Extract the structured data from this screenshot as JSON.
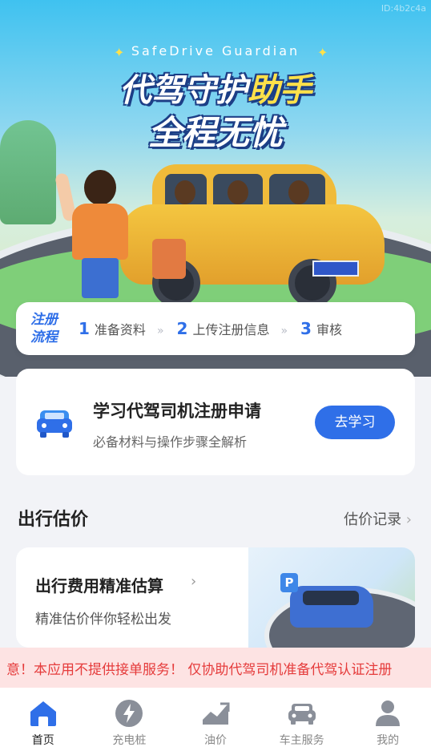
{
  "watermark": "ID:4b2c4a",
  "hero": {
    "tagline": "SafeDrive Guardian",
    "title_line1_a": "代驾守护",
    "title_line1_b": "助手",
    "title_line2": "全程无忧"
  },
  "steps": {
    "tag": "注册流程",
    "items": [
      {
        "num": "1",
        "label": "准备资料"
      },
      {
        "num": "2",
        "label": "上传注册信息"
      },
      {
        "num": "3",
        "label": "审核"
      }
    ],
    "separator": "»"
  },
  "learn_card": {
    "title": "学习代驾司机注册申请",
    "subtitle": "必备材料与操作步骤全解析",
    "button": "去学习",
    "icon": "car-icon"
  },
  "estimate_section": {
    "title": "出行估价",
    "link": "估价记录",
    "card_title": "出行费用精准估算",
    "card_subtitle": "精准估价伴你轻松出发",
    "sign_text": "P"
  },
  "notice": "意！本应用不提供接单服务！ 仅协助代驾司机准备代驾认证注册",
  "tabbar": [
    {
      "label": "首页",
      "icon": "home-icon",
      "active": true
    },
    {
      "label": "充电桩",
      "icon": "lightning-icon",
      "active": false
    },
    {
      "label": "油价",
      "icon": "chart-trend-icon",
      "active": false
    },
    {
      "label": "车主服务",
      "icon": "car-icon",
      "active": false
    },
    {
      "label": "我的",
      "icon": "person-icon",
      "active": false
    }
  ],
  "colors": {
    "accent": "#2f6fe8",
    "notice_bg": "#fde3e3",
    "notice_text": "#e53b3b"
  }
}
